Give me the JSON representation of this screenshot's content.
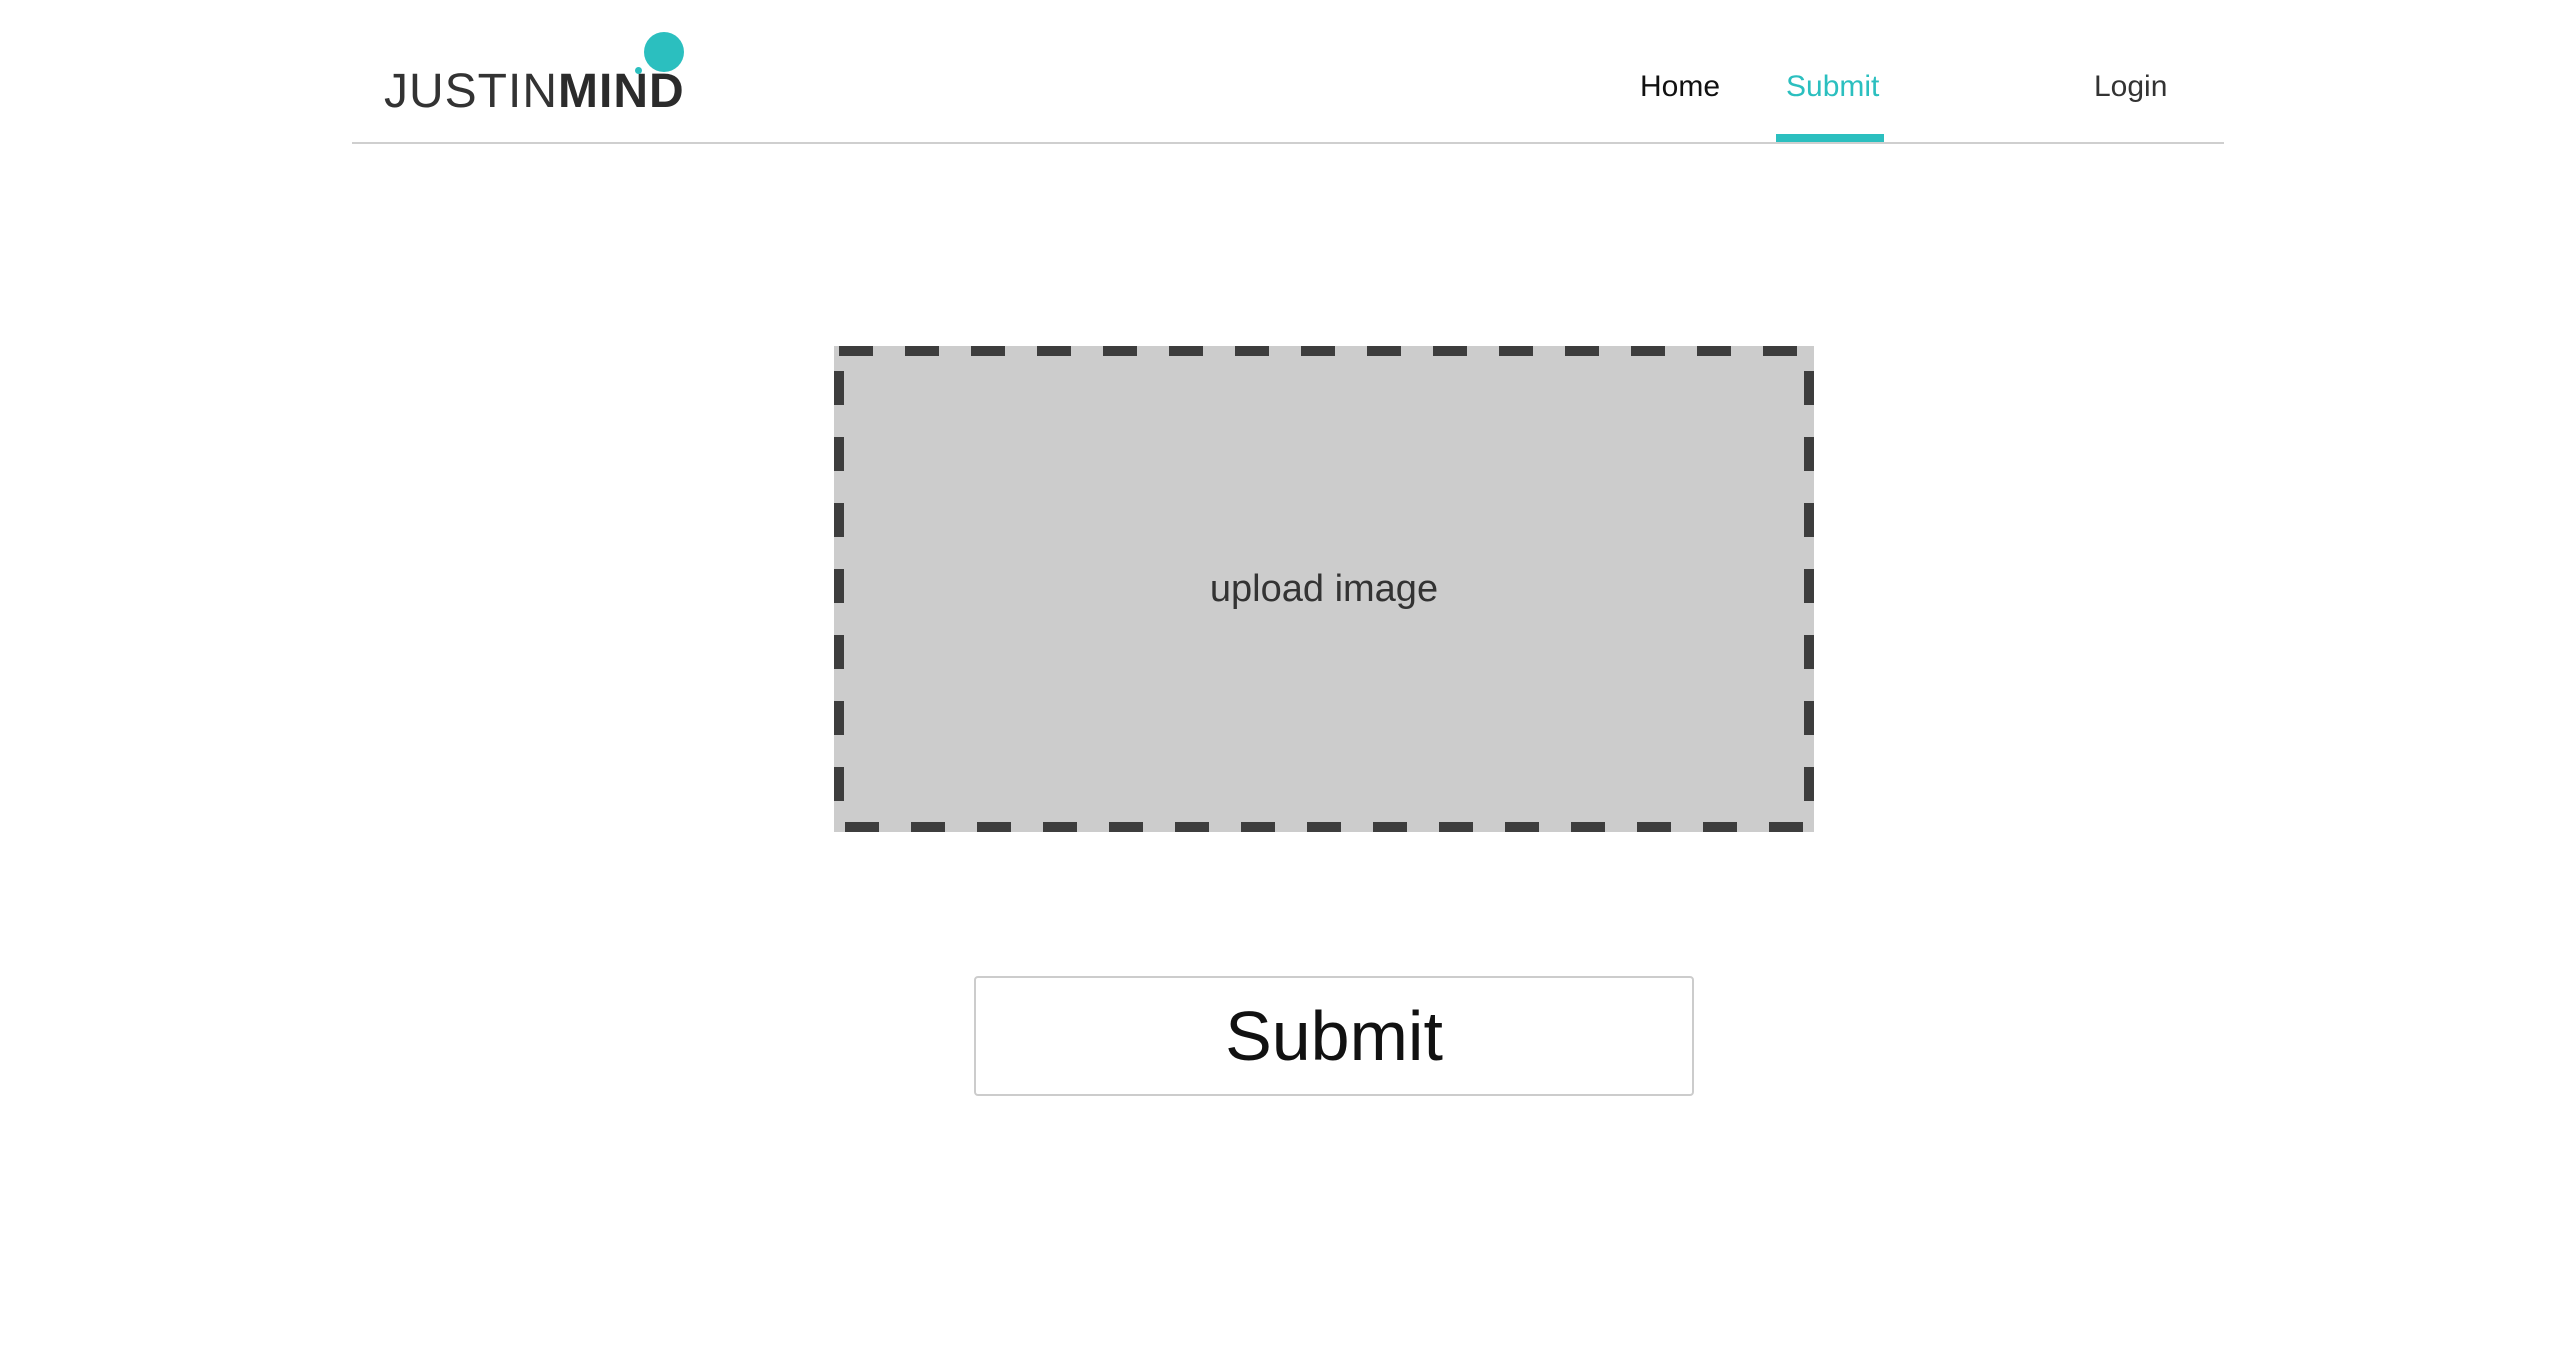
{
  "colors": {
    "accent": "#2bbfbf",
    "dropzone_fill": "#cccccc",
    "dropzone_border": "#3d3d3d"
  },
  "header": {
    "logo": {
      "text_light": "JUSTIN",
      "text_bold": "MIND"
    },
    "nav": {
      "home": "Home",
      "submit": "Submit",
      "login": "Login"
    },
    "active_tab": "Submit"
  },
  "main": {
    "upload_label": "upload image",
    "submit_button_label": "Submit"
  },
  "icons": {
    "upload_area": "dashed-dropzone"
  }
}
